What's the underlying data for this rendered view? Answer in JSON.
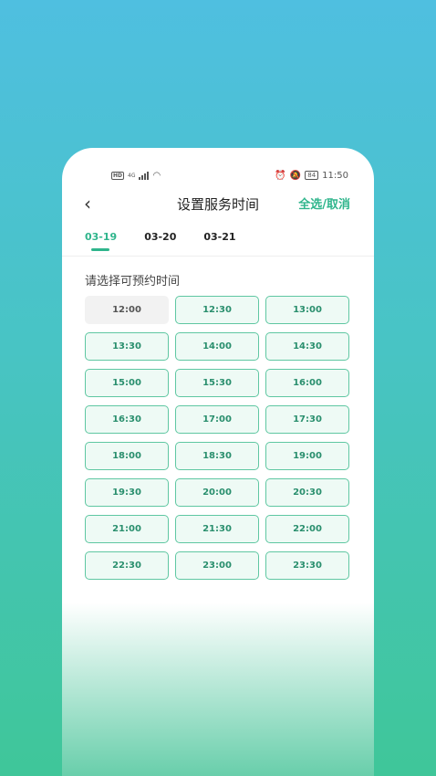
{
  "status_bar": {
    "time": "11:50",
    "battery": "84",
    "network": "4G",
    "hd": "HD"
  },
  "header": {
    "back_icon": "chevron-left-icon",
    "title": "设置服务时间",
    "action_label": "全选/取消"
  },
  "dates": [
    {
      "label": "03-19",
      "active": true
    },
    {
      "label": "03-20",
      "active": false
    },
    {
      "label": "03-21",
      "active": false
    }
  ],
  "hint": "请选择可预约时间",
  "slots": [
    {
      "time": "12:00",
      "disabled": true
    },
    {
      "time": "12:30"
    },
    {
      "time": "13:00"
    },
    {
      "time": "13:30"
    },
    {
      "time": "14:00"
    },
    {
      "time": "14:30"
    },
    {
      "time": "15:00"
    },
    {
      "time": "15:30"
    },
    {
      "time": "16:00"
    },
    {
      "time": "16:30"
    },
    {
      "time": "17:00"
    },
    {
      "time": "17:30"
    },
    {
      "time": "18:00"
    },
    {
      "time": "18:30"
    },
    {
      "time": "19:00"
    },
    {
      "time": "19:30"
    },
    {
      "time": "20:00"
    },
    {
      "time": "20:30"
    },
    {
      "time": "21:00"
    },
    {
      "time": "21:30"
    },
    {
      "time": "22:00"
    },
    {
      "time": "22:30"
    },
    {
      "time": "23:00"
    },
    {
      "time": "23:30"
    }
  ],
  "colors": {
    "accent": "#2fb58c",
    "slot_border": "#5fc7a2",
    "slot_bg": "#eefaf5",
    "disabled_bg": "#f2f2f2"
  }
}
